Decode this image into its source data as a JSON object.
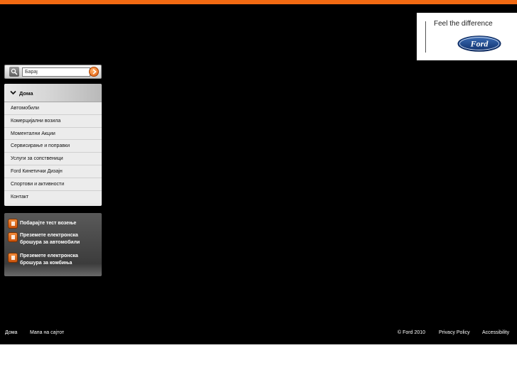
{
  "brand": {
    "tagline": "Feel the difference",
    "logo_text": "Ford"
  },
  "search": {
    "value": "Барај"
  },
  "nav": {
    "header": "Дома",
    "items": [
      "Автомобили",
      "Комерцијални возила",
      "Моментални Акции",
      "Сервисирање и поправки",
      "Услуги за сопственици",
      "Ford Кинетички Дизајн",
      "Спортови и активности",
      "Контакт"
    ]
  },
  "quick_links": [
    "Побарајте тест возење",
    "Преземете електронска брошура за автомобили",
    "Преземете електронска брошура за комбиња"
  ],
  "footer": {
    "home": "Дома",
    "sitemap": "Мапа на сајтот",
    "copyright": "© Ford 2010",
    "privacy": "Privacy Policy",
    "accessibility": "Accessibility"
  },
  "colors": {
    "accent": "#f26a12",
    "background": "#000000"
  }
}
